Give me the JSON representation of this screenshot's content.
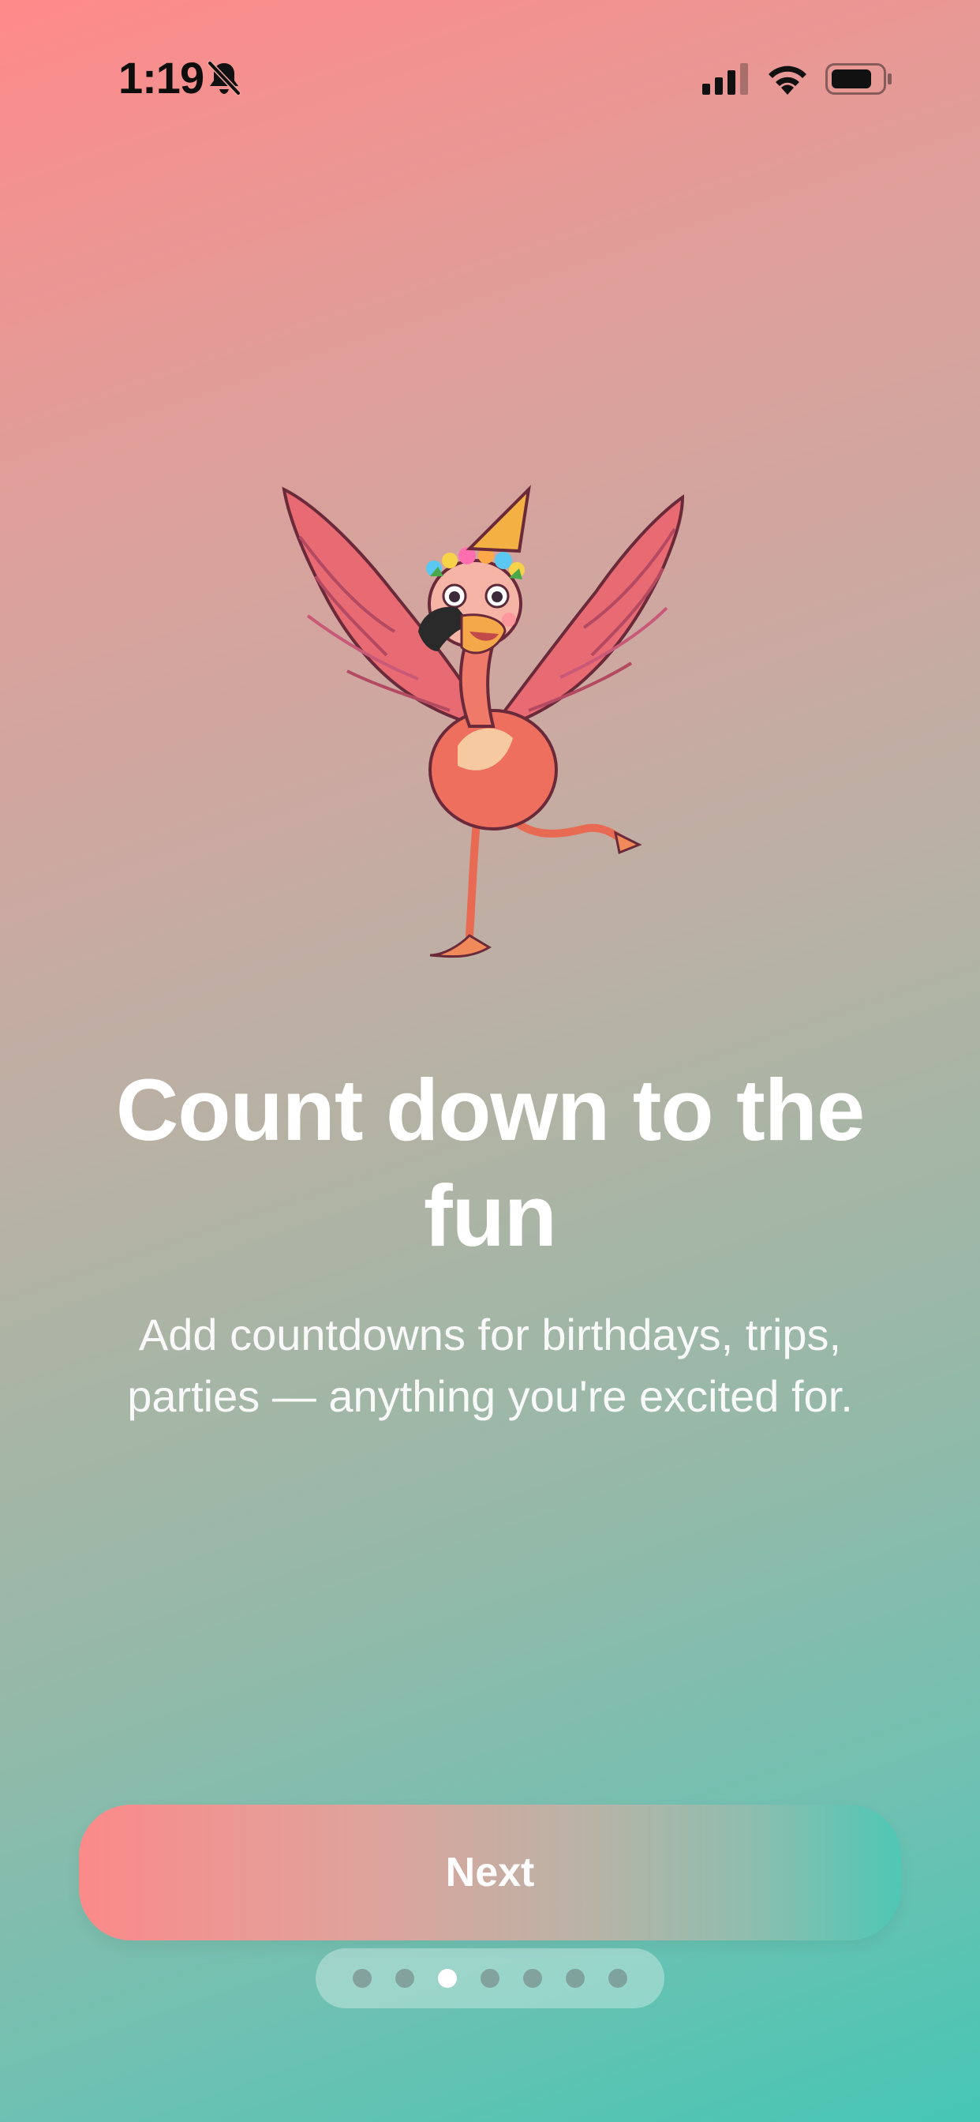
{
  "status_bar": {
    "time": "1:19",
    "icons": [
      "bell-slash-icon",
      "cellular-signal-icon",
      "wifi-icon",
      "battery-icon"
    ]
  },
  "illustration": "flamingo-mascot",
  "content": {
    "headline": "Count down to the fun",
    "subtitle": "Add countdowns for birthdays, trips, parties — anything you're excited for."
  },
  "button": {
    "next_label": "Next"
  },
  "pager": {
    "total": 7,
    "current": 3
  },
  "colors": {
    "gradient_top": "#ff8a8a",
    "gradient_bottom": "#46c6b4",
    "text": "#ffffff"
  }
}
